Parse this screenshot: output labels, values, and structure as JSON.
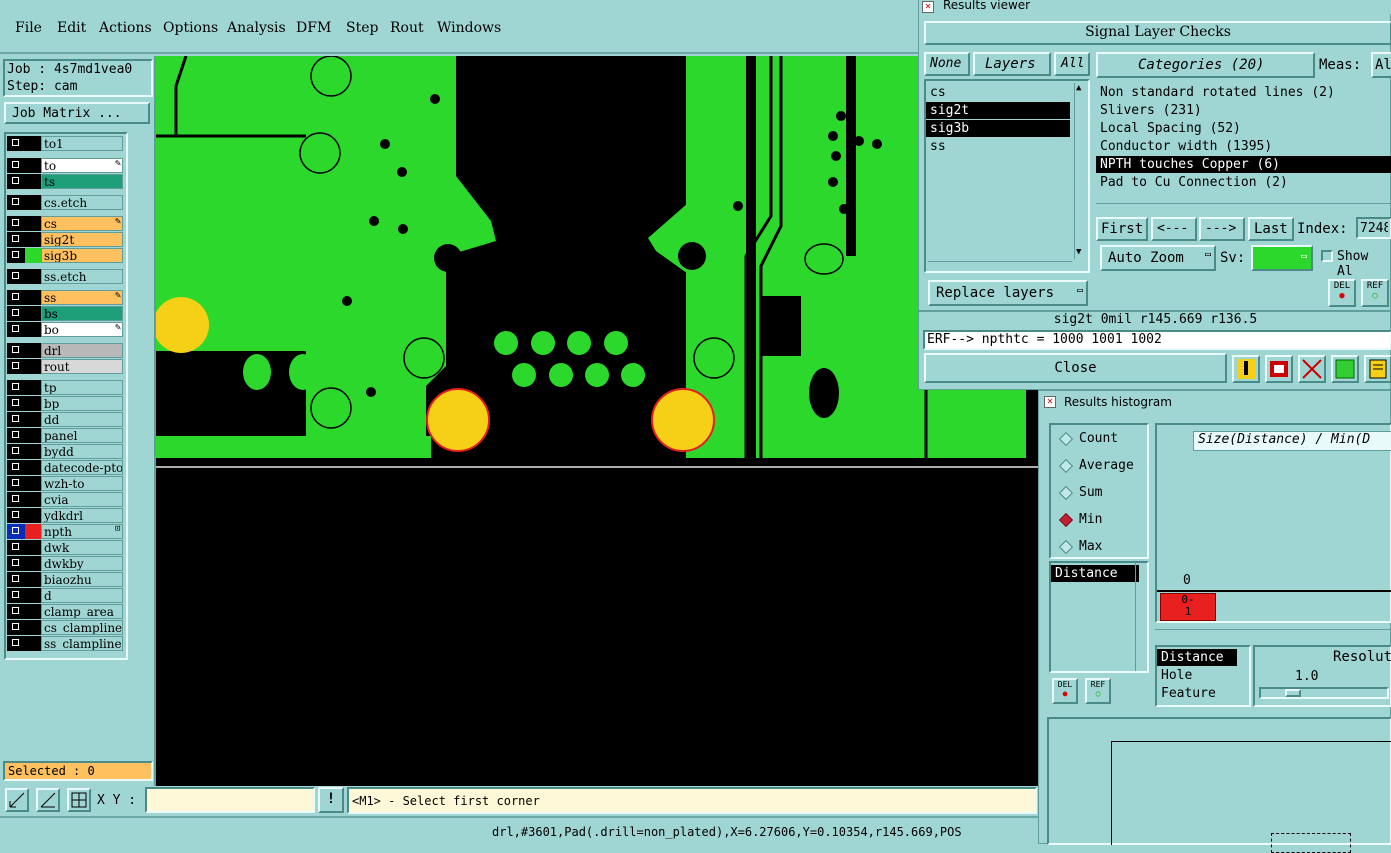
{
  "menubar": {
    "items": [
      "File",
      "Edit",
      "Actions",
      "Options",
      "Analysis",
      "DFM",
      "Step",
      "Rout",
      "Windows"
    ]
  },
  "job": {
    "job_label": "Job : 4s7md1vea0",
    "step_label": "Step: cam",
    "matrix_button": "Job Matrix ..."
  },
  "layers": [
    {
      "name": "to1",
      "color": "#000000",
      "bg": "#9fd6d3"
    },
    {
      "name": "to",
      "color": "#000000",
      "bg": "#ffffff",
      "icon": "pen"
    },
    {
      "name": "ts",
      "color": "#000000",
      "bg": "#1f9e7a"
    },
    {
      "name": "cs.etch",
      "color": "#000000",
      "bg": "#9fd6d3"
    },
    {
      "name": "cs",
      "color": "#000000",
      "bg": "#ffc060",
      "icon": "pen"
    },
    {
      "name": "sig2t",
      "color": "#000000",
      "bg": "#ffc060"
    },
    {
      "name": "sig3b",
      "color": "#2bd82b",
      "bg": "#ffc060"
    },
    {
      "name": "ss.etch",
      "color": "#000000",
      "bg": "#9fd6d3"
    },
    {
      "name": "ss",
      "color": "#000000",
      "bg": "#ffc060",
      "icon": "pen"
    },
    {
      "name": "bs",
      "color": "#000000",
      "bg": "#1f9e7a"
    },
    {
      "name": "bo",
      "color": "#000000",
      "bg": "#ffffff",
      "icon": "pen"
    },
    {
      "name": "drl",
      "color": "#000000",
      "bg": "#b8b8b8"
    },
    {
      "name": "rout",
      "color": "#000000",
      "bg": "#d8d8d8"
    },
    {
      "name": "tp",
      "color": "#000000",
      "bg": "#9fd6d3"
    },
    {
      "name": "bp",
      "color": "#000000",
      "bg": "#9fd6d3"
    },
    {
      "name": "dd",
      "color": "#000000",
      "bg": "#9fd6d3"
    },
    {
      "name": "panel",
      "color": "#000000",
      "bg": "#9fd6d3"
    },
    {
      "name": "bydd",
      "color": "#000000",
      "bg": "#9fd6d3"
    },
    {
      "name": "datecode-pto",
      "color": "#000000",
      "bg": "#9fd6d3"
    },
    {
      "name": "wzh-to",
      "color": "#000000",
      "bg": "#9fd6d3"
    },
    {
      "name": "cvia",
      "color": "#000000",
      "bg": "#9fd6d3"
    },
    {
      "name": "ydkdrl",
      "color": "#000000",
      "bg": "#9fd6d3"
    },
    {
      "name": "npth",
      "color": "#e82020",
      "bg": "#9fd6d3",
      "box": "#0a2ab8",
      "icon": "dot"
    },
    {
      "name": "dwk",
      "color": "#000000",
      "bg": "#9fd6d3"
    },
    {
      "name": "dwkby",
      "color": "#000000",
      "bg": "#9fd6d3"
    },
    {
      "name": "biaozhu",
      "color": "#000000",
      "bg": "#9fd6d3"
    },
    {
      "name": "d",
      "color": "#000000",
      "bg": "#9fd6d3"
    },
    {
      "name": "clamp_area",
      "color": "#000000",
      "bg": "#9fd6d3"
    },
    {
      "name": "cs_clampline",
      "color": "#000000",
      "bg": "#9fd6d3"
    },
    {
      "name": "ss_clampline",
      "color": "#000000",
      "bg": "#9fd6d3"
    }
  ],
  "selected_label": "Selected : 0",
  "command": {
    "xy_label": "X Y :",
    "xy_value": "",
    "prompt": "<M1> - Select first corner",
    "warn_label": "!"
  },
  "status": {
    "text": "drl,#3601,Pad(.drill=non_plated),X=6.27606,Y=0.10354,r145.669,POS"
  },
  "results_viewer": {
    "window_title": "Results viewer",
    "header": "Signal Layer Checks",
    "none_btn": "None",
    "layers_btn": "Layers",
    "all_btn": "All",
    "layers": [
      "cs",
      "sig2t",
      "sig3b",
      "ss"
    ],
    "selected_layers": [
      "sig2t",
      "sig3b"
    ],
    "categories_label": "Categories (20)",
    "meas_label": "Meas:",
    "meas_value": "Al",
    "categories": [
      "Non standard rotated lines (2)",
      "Slivers (231)",
      "Local Spacing (52)",
      "Conductor width (1395)",
      "NPTH touches Copper (6)",
      "Pad to Cu Connection (2)"
    ],
    "selected_category": "NPTH touches Copper (6)",
    "first_btn": "First",
    "prev_btn": "<---",
    "next_btn": "--->",
    "last_btn": "Last",
    "index_label": "Index:",
    "index_value": "7248",
    "auto_zoom": "Auto Zoom",
    "sv_label": "Sv:",
    "show_all": "Show Al",
    "replace_layers": "Replace layers",
    "del_label": "DEL",
    "ref_label": "REF",
    "info_line": "sig2t  0mil   r145.669   r136.5",
    "erf_line": "ERF--> npthtc = 1000 1001 1002",
    "close_btn": "Close",
    "colors": {
      "sv_green": "#2bd82b",
      "selected_bg": "#000000"
    }
  },
  "histogram": {
    "window_title": "Results histogram",
    "modes": [
      "Count",
      "Average",
      "Sum",
      "Min",
      "Max"
    ],
    "selected_mode": "Min",
    "list_item": "Distance",
    "chart_title": "Size(Distance) / Min(D",
    "axis_zero": "0",
    "bar_label_top": "0-",
    "bar_label_bottom": "1",
    "attrs": [
      "Distance",
      "Hole",
      "Feature"
    ],
    "selected_attr": "Distance",
    "resolution_label": "Resolut",
    "resolution_value": "1.0",
    "del_label": "DEL",
    "ref_label": "REF",
    "bar_color": "#e82020"
  }
}
